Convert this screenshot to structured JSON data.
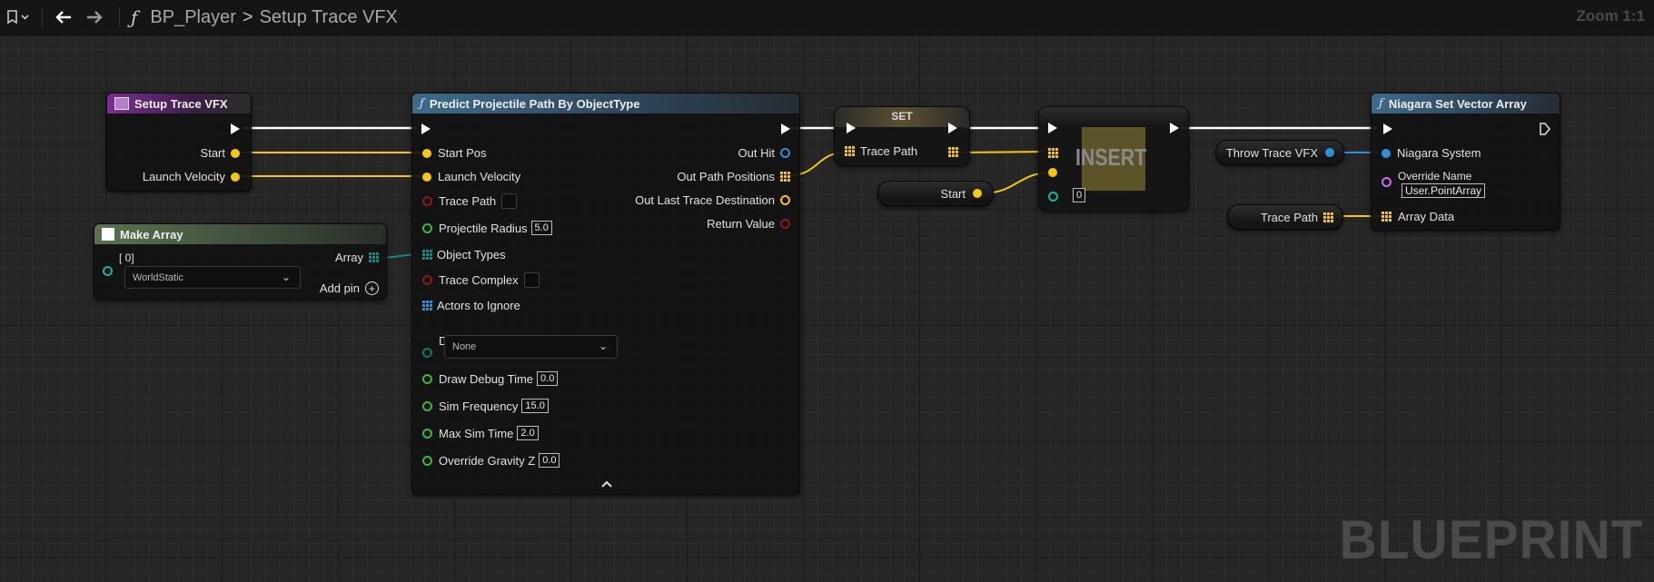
{
  "toolbar": {
    "breadcrumb_root": "BP_Player",
    "breadcrumb_separator": ">",
    "breadcrumb_current": "Setup Trace VFX",
    "zoom": "Zoom 1:1"
  },
  "watermark": "BLUEPRINT",
  "colors": {
    "exec": "#ffffff",
    "vector": "#f5c518",
    "struct": "#2f8fd8",
    "bool": "#8b1a1a",
    "float": "#3cb83c",
    "object": "#18b4a0",
    "string": "#d070f0"
  },
  "nodes": {
    "setup": {
      "title": "Setup Trace VFX",
      "pins": {
        "start": "Start",
        "launch_velocity": "Launch Velocity"
      }
    },
    "make_array": {
      "title": "Make Array",
      "index": "[ 0]",
      "dropdown": "WorldStatic",
      "array": "Array",
      "add_pin": "Add pin"
    },
    "predict": {
      "title": "Predict Projectile Path By ObjectType",
      "inputs": {
        "start_pos": "Start Pos",
        "launch_velocity": "Launch Velocity",
        "trace_path": "Trace Path",
        "projectile_radius": "Projectile Radius",
        "projectile_radius_value": "5.0",
        "object_types": "Object Types",
        "trace_complex": "Trace Complex",
        "actors_to_ignore": "Actors to Ignore",
        "draw_debug_type": "Draw Debug Type",
        "draw_debug_type_value": "None",
        "draw_debug_time": "Draw Debug Time",
        "draw_debug_time_value": "0.0",
        "sim_frequency": "Sim Frequency",
        "sim_frequency_value": "15.0",
        "max_sim_time": "Max Sim Time",
        "max_sim_time_value": "2.0",
        "override_gravity_z": "Override Gravity Z",
        "override_gravity_z_value": "0.0"
      },
      "outputs": {
        "out_hit": "Out Hit",
        "out_path_positions": "Out Path Positions",
        "out_last_trace_destination": "Out Last Trace Destination",
        "return_value": "Return Value"
      },
      "collapse_icon": "chevron-up-icon"
    },
    "set": {
      "title": "SET",
      "pin": "Trace Path"
    },
    "start_var": {
      "label": "Start"
    },
    "insert": {
      "label": "INSERT",
      "index_value": "0"
    },
    "throw_trace_vfx": {
      "label": "Throw Trace VFX"
    },
    "trace_path_var": {
      "label": "Trace Path"
    },
    "niagara": {
      "title": "Niagara Set Vector Array",
      "pins": {
        "niagara_system": "Niagara System",
        "override_name": "Override Name",
        "override_name_value": "User.PointArray",
        "array_data": "Array Data"
      }
    }
  }
}
